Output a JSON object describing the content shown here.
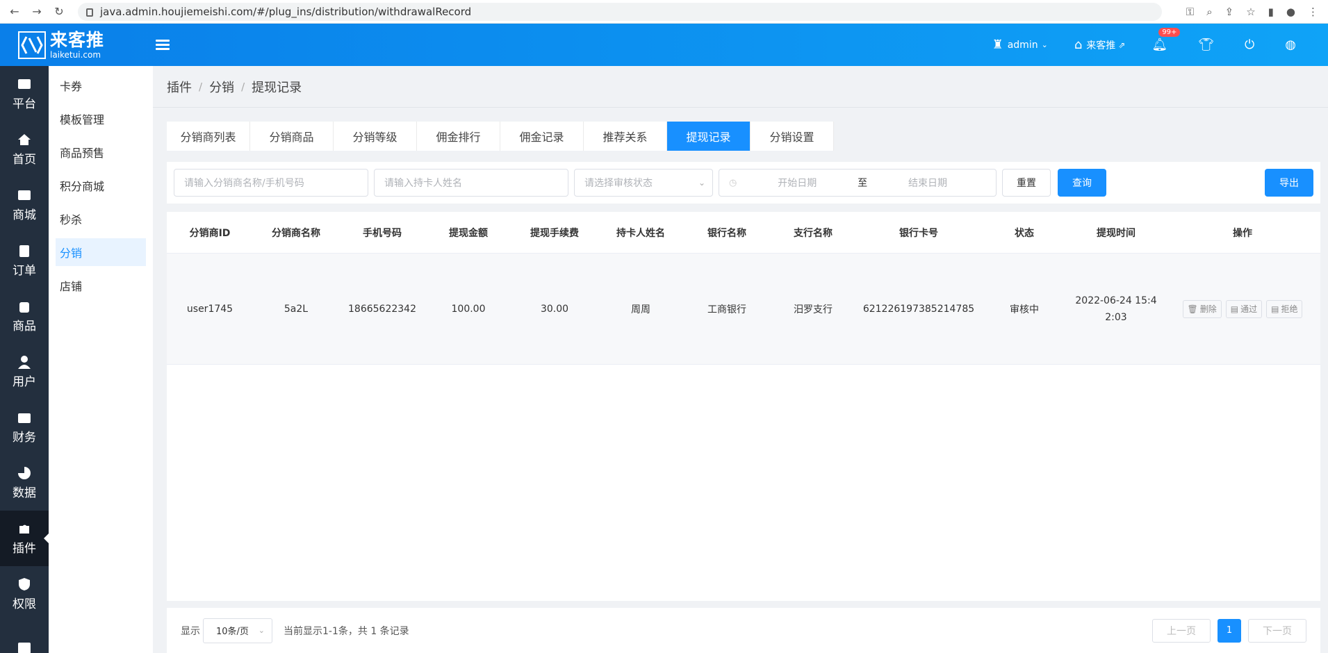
{
  "browser": {
    "url": "java.admin.houjiemeishi.com/#/plug_ins/distribution/withdrawalRecord"
  },
  "header": {
    "logo_cn": "来客推",
    "logo_en": "laiketui.com",
    "user": "admin",
    "store": "来客推",
    "notify_badge": "99+"
  },
  "sidebar": {
    "items": [
      {
        "label": "平台",
        "icon": "platform-icon"
      },
      {
        "label": "首页",
        "icon": "home-icon"
      },
      {
        "label": "商城",
        "icon": "mall-icon"
      },
      {
        "label": "订单",
        "icon": "order-icon"
      },
      {
        "label": "商品",
        "icon": "goods-icon"
      },
      {
        "label": "用户",
        "icon": "user-icon"
      },
      {
        "label": "财务",
        "icon": "wallet-icon"
      },
      {
        "label": "数据",
        "icon": "pie-icon"
      },
      {
        "label": "插件",
        "icon": "puzzle-icon",
        "active": true
      },
      {
        "label": "权限",
        "icon": "shield-icon"
      }
    ]
  },
  "submenu": {
    "items": [
      "卡券",
      "模板管理",
      "商品预售",
      "积分商城",
      "秒杀",
      "分销",
      "店铺"
    ]
  },
  "breadcrumb": {
    "items": [
      "插件",
      "分销",
      "提现记录"
    ]
  },
  "tabs": [
    "分销商列表",
    "分销商品",
    "分销等级",
    "佣金排行",
    "佣金记录",
    "推荐关系",
    "提现记录",
    "分销设置"
  ],
  "filter": {
    "name_placeholder": "请输入分销商名称/手机号码",
    "holder_placeholder": "请输入持卡人姓名",
    "status_placeholder": "请选择审核状态",
    "start_placeholder": "开始日期",
    "to_label": "至",
    "end_placeholder": "结束日期",
    "reset": "重置",
    "query": "查询",
    "export": "导出"
  },
  "table": {
    "headers": [
      "分销商ID",
      "分销商名称",
      "手机号码",
      "提现金额",
      "提现手续费",
      "持卡人姓名",
      "银行名称",
      "支行名称",
      "银行卡号",
      "状态",
      "提现时间",
      "操作"
    ],
    "rows": [
      [
        "user1745",
        "5a2L",
        "18665622342",
        "100.00",
        "30.00",
        "周周",
        "工商银行",
        "汨罗支行",
        "621226197385214785",
        "审核中",
        "2022-06-24 15:42:03"
      ]
    ],
    "ops": [
      "删除",
      "通过",
      "拒绝"
    ]
  },
  "pager": {
    "show_label": "显示",
    "page_size": "10条/页",
    "summary": "当前显示1-1条，共 1 条记录",
    "prev": "上一页",
    "page": "1",
    "next": "下一页"
  }
}
